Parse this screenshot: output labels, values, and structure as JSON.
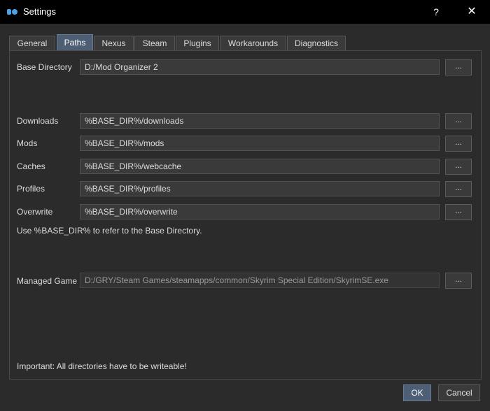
{
  "window": {
    "title": "Settings",
    "help": "?",
    "close": "✕",
    "icon": "mod-organizer-icon"
  },
  "tabs": [
    {
      "label": "General",
      "active": false
    },
    {
      "label": "Paths",
      "active": true
    },
    {
      "label": "Nexus",
      "active": false
    },
    {
      "label": "Steam",
      "active": false
    },
    {
      "label": "Plugins",
      "active": false
    },
    {
      "label": "Workarounds",
      "active": false
    },
    {
      "label": "Diagnostics",
      "active": false
    }
  ],
  "paths": {
    "base": {
      "label": "Base Directory",
      "value": "D:/Mod Organizer 2"
    },
    "downloads": {
      "label": "Downloads",
      "value": "%BASE_DIR%/downloads"
    },
    "mods": {
      "label": "Mods",
      "value": "%BASE_DIR%/mods"
    },
    "caches": {
      "label": "Caches",
      "value": "%BASE_DIR%/webcache"
    },
    "profiles": {
      "label": "Profiles",
      "value": "%BASE_DIR%/profiles"
    },
    "overwrite": {
      "label": "Overwrite",
      "value": "%BASE_DIR%/overwrite"
    },
    "managed": {
      "label": "Managed Game",
      "value": "D:/GRY/Steam Games/steamapps/common/Skyrim Special Edition/SkyrimSE.exe"
    }
  },
  "browse_label": "...",
  "hint": "Use %BASE_DIR% to refer to the Base Directory.",
  "important": "Important: All directories have to be writeable!",
  "buttons": {
    "ok": "OK",
    "cancel": "Cancel"
  },
  "colors": {
    "accent": "#4e5e75",
    "background": "#2b2b2b",
    "titlebar": "#000000"
  }
}
